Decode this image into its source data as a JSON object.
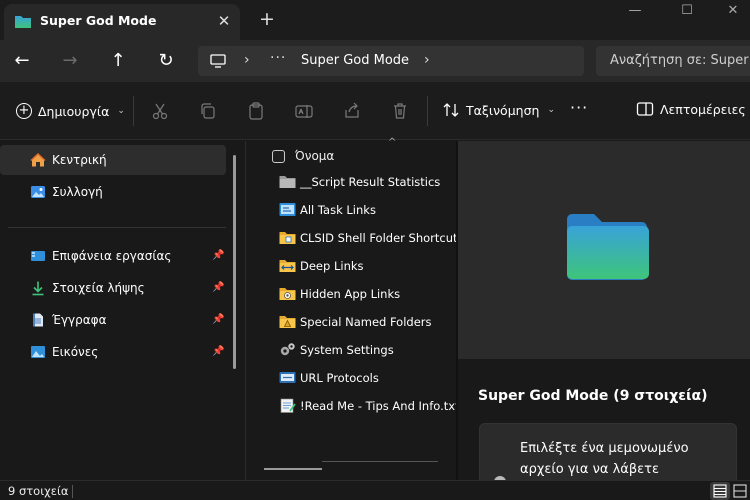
{
  "window": {
    "tab_title": "Super God Mode",
    "tab_close": "✕",
    "new_tab": "+",
    "controls": {
      "minimize": "—",
      "maximize": "☐",
      "close": "✕"
    }
  },
  "nav": {
    "back": "←",
    "forward": "→",
    "up": "↑",
    "refresh": "↻"
  },
  "address": {
    "chevron": "›",
    "overflow": "···",
    "current": "Super God Mode",
    "trailing_chevron": "›"
  },
  "search": {
    "placeholder": "Αναζήτηση σε: Super God Mode"
  },
  "command_bar": {
    "new_label": "Δημιουργία",
    "sort_label": "Ταξινόμηση",
    "more": "···",
    "details_label": "Λεπτομέρειες",
    "dropdown": "⌄"
  },
  "sidebar": {
    "items": [
      {
        "label": "Κεντρική",
        "icon": "home-icon",
        "active": true
      },
      {
        "label": "Συλλογή",
        "icon": "gallery-icon",
        "active": false
      }
    ],
    "pinned": [
      {
        "label": "Επιφάνεια εργασίας",
        "icon": "desktop-icon"
      },
      {
        "label": "Στοιχεία λήψης",
        "icon": "downloads-icon"
      },
      {
        "label": "Έγγραφα",
        "icon": "documents-icon"
      },
      {
        "label": "Εικόνες",
        "icon": "pictures-icon"
      }
    ]
  },
  "filelist": {
    "column_name": "Όνομα",
    "sort_caret": "^",
    "files": [
      {
        "name": "__Script Result Statistics",
        "icon": "grey-folder-icon"
      },
      {
        "name": "All Task Links",
        "icon": "task-links-icon"
      },
      {
        "name": "CLSID Shell Folder Shortcuts",
        "icon": "clsid-folder-icon"
      },
      {
        "name": "Deep Links",
        "icon": "deep-links-folder-icon"
      },
      {
        "name": "Hidden App Links",
        "icon": "hidden-app-folder-icon"
      },
      {
        "name": "Special Named Folders",
        "icon": "special-folder-icon"
      },
      {
        "name": "System Settings",
        "icon": "gears-icon"
      },
      {
        "name": "URL Protocols",
        "icon": "url-protocols-icon"
      },
      {
        "name": "!Read Me - Tips And Info.txt",
        "icon": "notepad-icon"
      }
    ]
  },
  "details": {
    "title": "Super God Mode (9 στοιχεία)",
    "hint": "Επιλέξτε ένα μεμονωμένο αρχείο για να λάβετε"
  },
  "status": {
    "count": "9 στοιχεία"
  },
  "colors": {
    "folder_top": "#38a3d8",
    "folder_bottom": "#3ec47a",
    "accent": "#2b88d8"
  }
}
